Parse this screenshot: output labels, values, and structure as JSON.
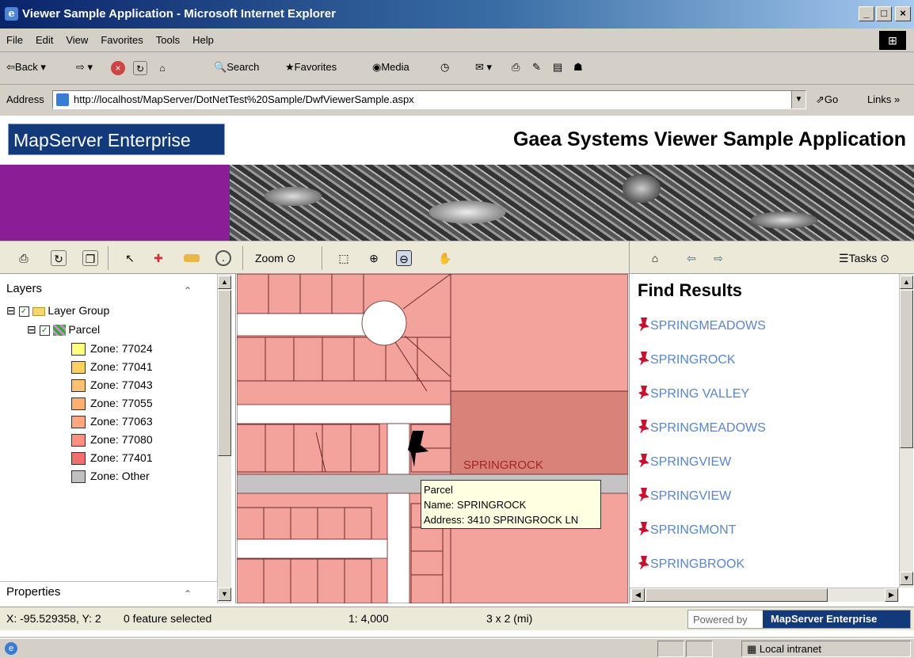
{
  "window": {
    "title": "Viewer Sample Application - Microsoft Internet Explorer",
    "controls": [
      "_",
      "□",
      "×"
    ]
  },
  "menu": [
    "File",
    "Edit",
    "View",
    "Favorites",
    "Tools",
    "Help"
  ],
  "toolbar": {
    "back": "Back",
    "search": "Search",
    "favorites": "Favorites",
    "media": "Media"
  },
  "address": {
    "label": "Address",
    "url": "http://localhost/MapServer/DotNetTest%20Sample/DwfViewerSample.aspx",
    "go": "Go",
    "links": "Links"
  },
  "header": {
    "logo": "MapServer Enterprise",
    "title": "Gaea Systems Viewer Sample Application"
  },
  "map_toolbar": {
    "zoom_label": "Zoom",
    "tasks_label": "Tasks"
  },
  "layers": {
    "title": "Layers",
    "group": "Layer Group",
    "layer": "Parcel",
    "zones": [
      {
        "label": "Zone: 77024",
        "color": "#ffff80"
      },
      {
        "label": "Zone: 77041",
        "color": "#ffd060"
      },
      {
        "label": "Zone: 77043",
        "color": "#ffc070"
      },
      {
        "label": "Zone: 77055",
        "color": "#ffb070"
      },
      {
        "label": "Zone: 77063",
        "color": "#ffa880"
      },
      {
        "label": "Zone: 77080",
        "color": "#ff9080"
      },
      {
        "label": "Zone:  77401",
        "color": "#f07070"
      },
      {
        "label": "Zone: Other",
        "color": "#c0c0c0"
      }
    ]
  },
  "properties": {
    "title": "Properties"
  },
  "map": {
    "label": "SPRINGROCK",
    "tooltip": {
      "line1": "Parcel",
      "line2": "Name: SPRINGROCK",
      "line3": "Address: 3410 SPRINGROCK LN"
    }
  },
  "results": {
    "title": "Find Results",
    "items": [
      "SPRINGMEADOWS",
      "SPRINGROCK",
      "SPRING VALLEY",
      "SPRINGMEADOWS",
      "SPRINGVIEW",
      "SPRINGVIEW",
      "SPRINGMONT",
      "SPRINGBROOK"
    ]
  },
  "status": {
    "coords": "X: -95.529358, Y: 2",
    "selected": "0 feature selected",
    "scale": "1: 4,000",
    "extent": "3 x 2 (mi)",
    "powered_by": "Powered by",
    "brand": "MapServer Enterprise"
  },
  "ie_status": {
    "zone": "Local intranet"
  }
}
